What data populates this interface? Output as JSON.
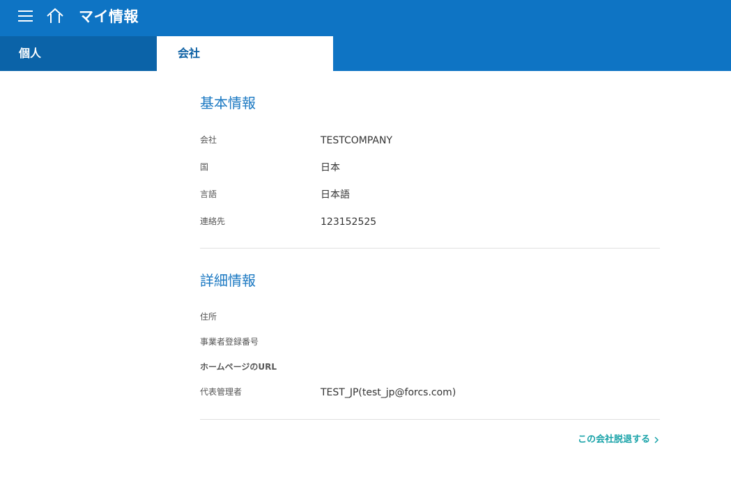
{
  "header": {
    "title": "マイ情報",
    "icons": [
      "menu-icon",
      "home-icon"
    ]
  },
  "tabs": [
    {
      "label": "個人",
      "active": false
    },
    {
      "label": "会社",
      "active": true
    }
  ],
  "basic_info": {
    "title": "基本情報",
    "rows": [
      {
        "label": "会社",
        "value": "TESTCOMPANY"
      },
      {
        "label": "国",
        "value": "日本"
      },
      {
        "label": "言語",
        "value": "日本語"
      },
      {
        "label": "連絡先",
        "value": "123152525"
      }
    ]
  },
  "detail_info": {
    "title": "詳細情報",
    "rows": [
      {
        "label": "住所",
        "value": ""
      },
      {
        "label": "事業者登録番号",
        "value": ""
      },
      {
        "label": "ホームページのURL",
        "value": ""
      },
      {
        "label": "代表管理者",
        "value": "TEST_JP(test_jp@forcs.com)"
      }
    ]
  },
  "actions": {
    "leave_company": "この会社脱退する"
  },
  "colors": {
    "header_bg": "#0e74c4",
    "inactive_tab_bg": "#0b63a8",
    "section_title": "#1a78c2",
    "link": "#17a2a8"
  }
}
